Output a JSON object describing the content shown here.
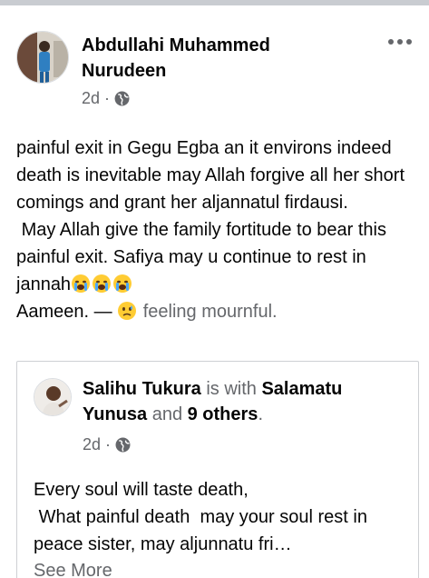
{
  "post": {
    "author": "Abdullahi Muhammed Nurudeen",
    "time": "2d",
    "separator": "·",
    "privacy_icon": "globe-icon",
    "body_line1": "painful exit in Gegu Egba an it environs indeed death is inevitable may Allah forgive all her short comings and grant her aljannatul firdausi.",
    "body_line2": " May Allah give the family fortitude to bear this painful exit. Safiya may u continue to rest in jannah",
    "body_line3": "Aameen. — ",
    "emoji_crying": "crying-face-emoji",
    "emoji_sad": "sad-but-relieved-emoji",
    "feeling": "feeling mournful."
  },
  "shared": {
    "author": "Salihu Tukura",
    "with_text": " is with ",
    "tagged": "Salamatu Yunusa",
    "and_text": " and ",
    "others": "9 others",
    "period": ".",
    "time": "2d",
    "separator": "·",
    "privacy_icon": "globe-icon",
    "text": "Every soul will taste death,\n What painful death  may your soul rest in peace sister, may aljunnatu fri…",
    "see_more": "See More"
  },
  "colors": {
    "text": "#050505",
    "secondary": "#65676b",
    "divider": "#c9ccd1",
    "border": "#ced0d4"
  }
}
